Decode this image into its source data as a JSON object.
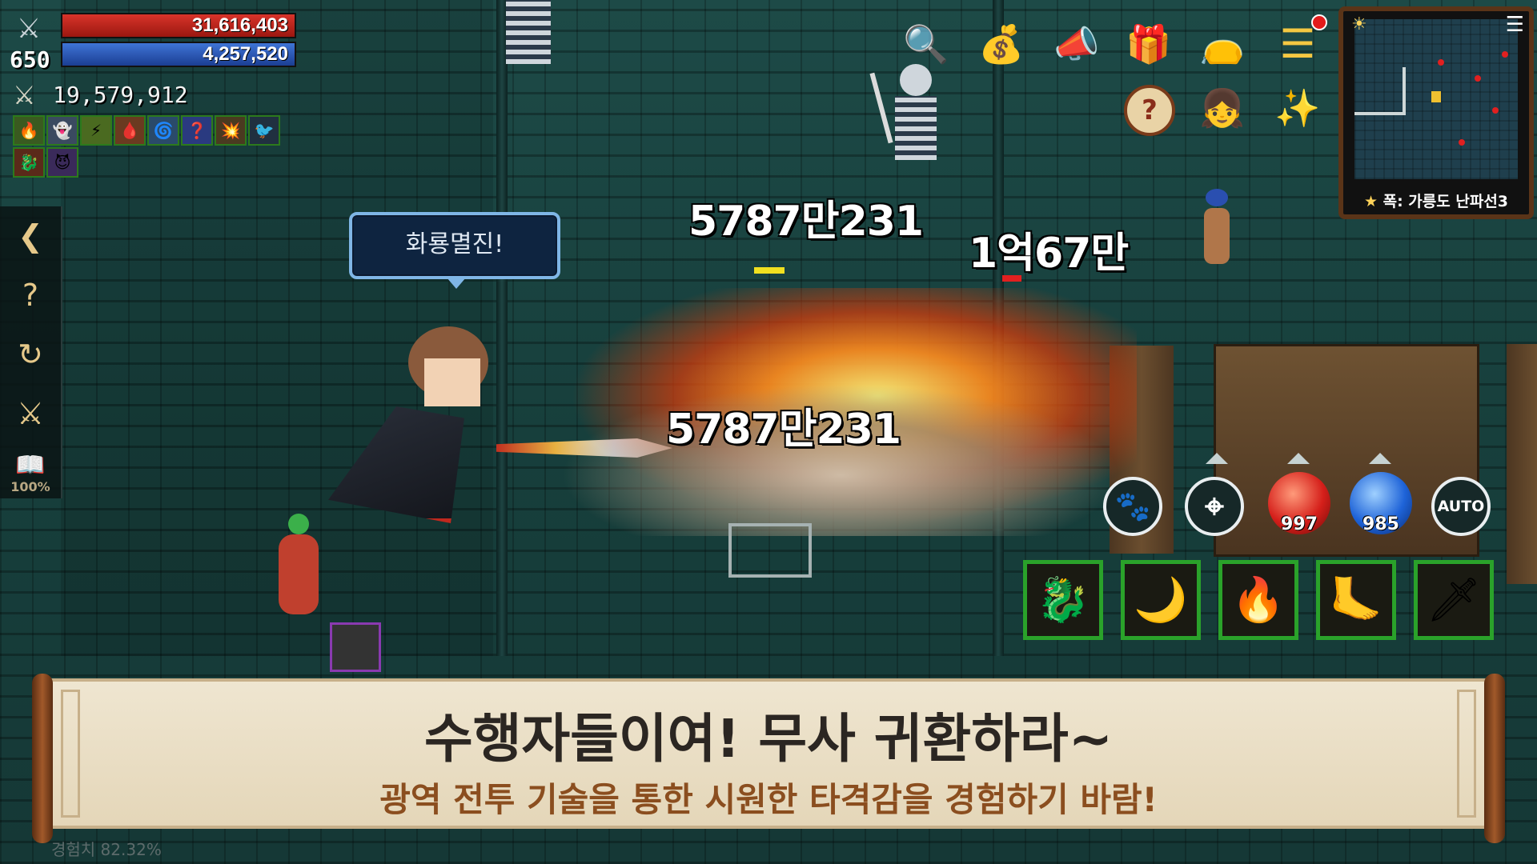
{
  "player": {
    "level": "650",
    "hp": "31,616,403",
    "mp": "4,257,520",
    "combat_power": "19,579,912",
    "class_icon": "crossed-swords-icon",
    "hp_color": "#c62a22",
    "mp_color": "#2d58b8"
  },
  "buffs": [
    "🔥",
    "👻",
    "⚡",
    "🩸",
    "🌀",
    "❓",
    "💥",
    "🐦",
    "🐉",
    "😈"
  ],
  "left_menu": {
    "items": [
      {
        "icon": "back-arrow-icon",
        "glyph": "❮"
      },
      {
        "icon": "quest-scroll-icon",
        "glyph": "?"
      },
      {
        "icon": "repeat-quest-icon",
        "glyph": "↻"
      },
      {
        "icon": "battle-icon",
        "glyph": "⚔"
      },
      {
        "icon": "book-icon",
        "glyph": "📖"
      }
    ],
    "book_percent": "100%"
  },
  "top_icons": [
    {
      "name": "search-icon",
      "glyph": "🔍"
    },
    {
      "name": "reward-bag-icon",
      "glyph": "💰"
    },
    {
      "name": "megaphone-icon",
      "glyph": "📣"
    },
    {
      "name": "gift-icon",
      "glyph": "🎁"
    },
    {
      "name": "pouch-icon",
      "glyph": "👝"
    },
    {
      "name": "menu-icon",
      "glyph": "☰"
    },
    {
      "name": "help-icon",
      "glyph": "?"
    },
    {
      "name": "character-icon",
      "glyph": "👧"
    },
    {
      "name": "magic-wand-icon",
      "glyph": "✨"
    }
  ],
  "minimap": {
    "location": "폭: 가릉도 난파선3",
    "time_icon": "sun-icon",
    "menu_icon": "list-icon"
  },
  "speech_bubble": "화룡멸진!",
  "damage_numbers": [
    "5787만231",
    "1억67만",
    "5787만231"
  ],
  "actions": {
    "pet_button": "paw-icon",
    "target_button": "crosshair-icon",
    "hp_potion_count": "997",
    "mp_potion_count": "985",
    "auto_label": "AUTO"
  },
  "skills": [
    "fire-dragon-skill-icon",
    "slash-skill-icon",
    "fire-spin-skill-icon",
    "kick-skill-icon",
    "sword-buff-skill-icon"
  ],
  "banner": {
    "title": "수행자들이여! 무사 귀환하라~",
    "subtitle": "광역 전투 기술을 통한 시원한 타격감을 경험하기 바람!"
  },
  "experience": "경험치 82.32%"
}
